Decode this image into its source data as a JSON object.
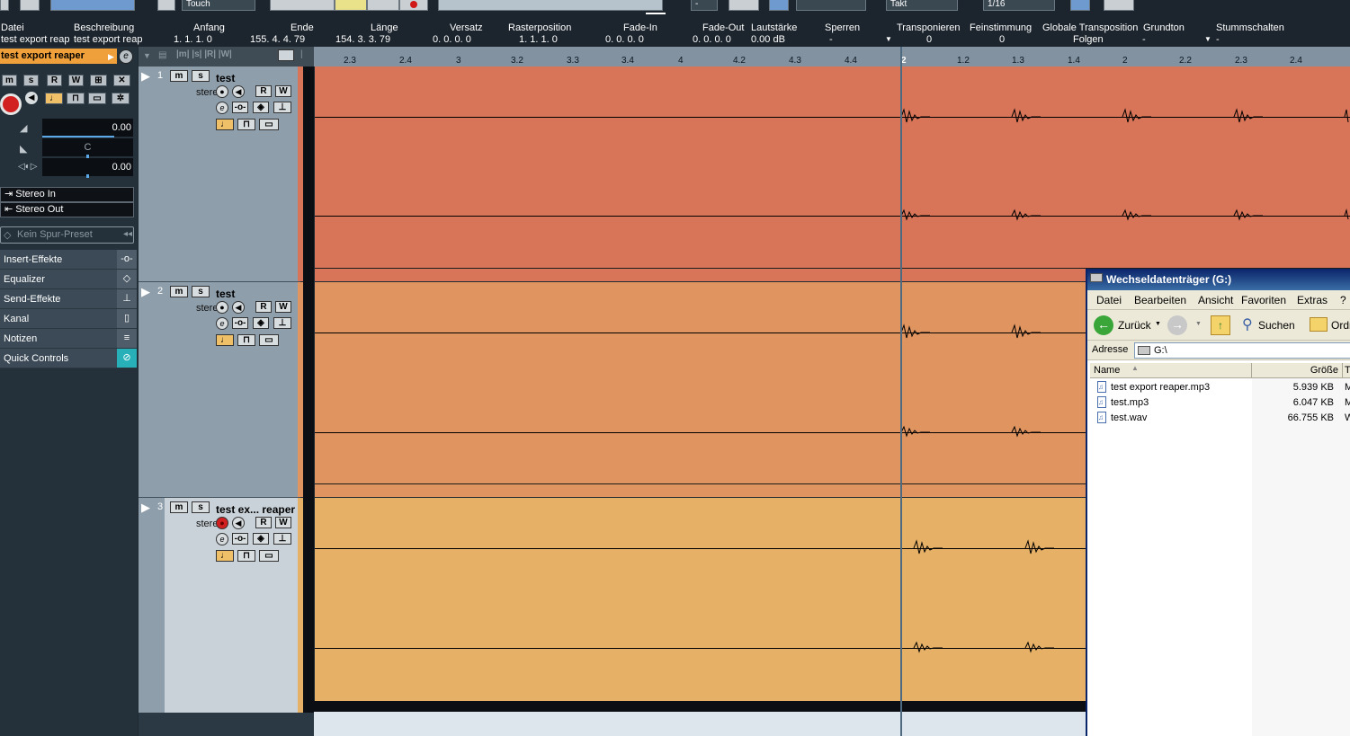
{
  "toolbar": {
    "automation_mode": "Touch",
    "grid_type": "Takt",
    "quantize": "1/16",
    "nudge_value": "-"
  },
  "infoline": {
    "headers": [
      "Datei",
      "Beschreibung",
      "Anfang",
      "Ende",
      "Länge",
      "Versatz",
      "Rasterposition",
      "Fade-In",
      "Fade-Out",
      "Lautstärke",
      "Sperren",
      "Transponieren",
      "Feinstimmung",
      "Globale Transposition",
      "Grundton",
      "Stummschalten"
    ],
    "values": [
      "test export reap",
      "test export reap",
      "1. 1. 1.   0",
      "155. 4. 4. 79",
      "154. 3. 3. 79",
      "0. 0. 0.   0",
      "1. 1. 1.   0",
      "0. 0. 0.   0",
      "0. 0. 0.   0",
      "0.00 dB",
      "-",
      "0",
      "0",
      "Folgen",
      "-",
      "-"
    ]
  },
  "inspector": {
    "track_name": "test export reaper",
    "volume": "0.00",
    "pan": "C",
    "delay": "0.00",
    "input": "Stereo In",
    "output": "Stereo Out",
    "preset_placeholder": "Kein Spur-Preset",
    "sections": [
      "Insert-Effekte",
      "Equalizer",
      "Send-Effekte",
      "Kanal",
      "Notizen",
      "Quick Controls"
    ],
    "buttons": [
      "m",
      "s",
      "R",
      "W"
    ]
  },
  "tracks": [
    {
      "number": "1",
      "name": "test",
      "type": "stereo",
      "color": "#d87458"
    },
    {
      "number": "2",
      "name": "test",
      "type": "stereo",
      "color": "#e09560"
    },
    {
      "number": "3",
      "name": "test ex... reaper",
      "type": "stereo",
      "color": "#e6b066"
    }
  ],
  "track_buttons": {
    "mute": "m",
    "solo": "s",
    "read": "R",
    "write": "W",
    "edit": "e"
  },
  "ruler": {
    "ticks": [
      "2.3",
      "2.4",
      "3",
      "3.2",
      "3.3",
      "3.4",
      "4",
      "4.2",
      "4.3",
      "4.4",
      "2",
      "1.2",
      "1.3",
      "1.4",
      "2",
      "2.2",
      "2.3",
      "2.4"
    ]
  },
  "explorer": {
    "title": "Wechseldatenträger (G:)",
    "menu": [
      "Datei",
      "Bearbeiten",
      "Ansicht",
      "Favoriten",
      "Extras",
      "?"
    ],
    "back_label": "Zurück",
    "search_label": "Suchen",
    "folders_label": "Ordn",
    "address_label": "Adresse",
    "address_value": "G:\\",
    "columns": [
      "Name",
      "Größe",
      "Ty"
    ],
    "files": [
      {
        "name": "test export reaper.mp3",
        "size": "5.939 KB",
        "type": "M"
      },
      {
        "name": "test.mp3",
        "size": "6.047 KB",
        "type": "M"
      },
      {
        "name": "test.wav",
        "size": "66.755 KB",
        "type": "W"
      }
    ]
  }
}
